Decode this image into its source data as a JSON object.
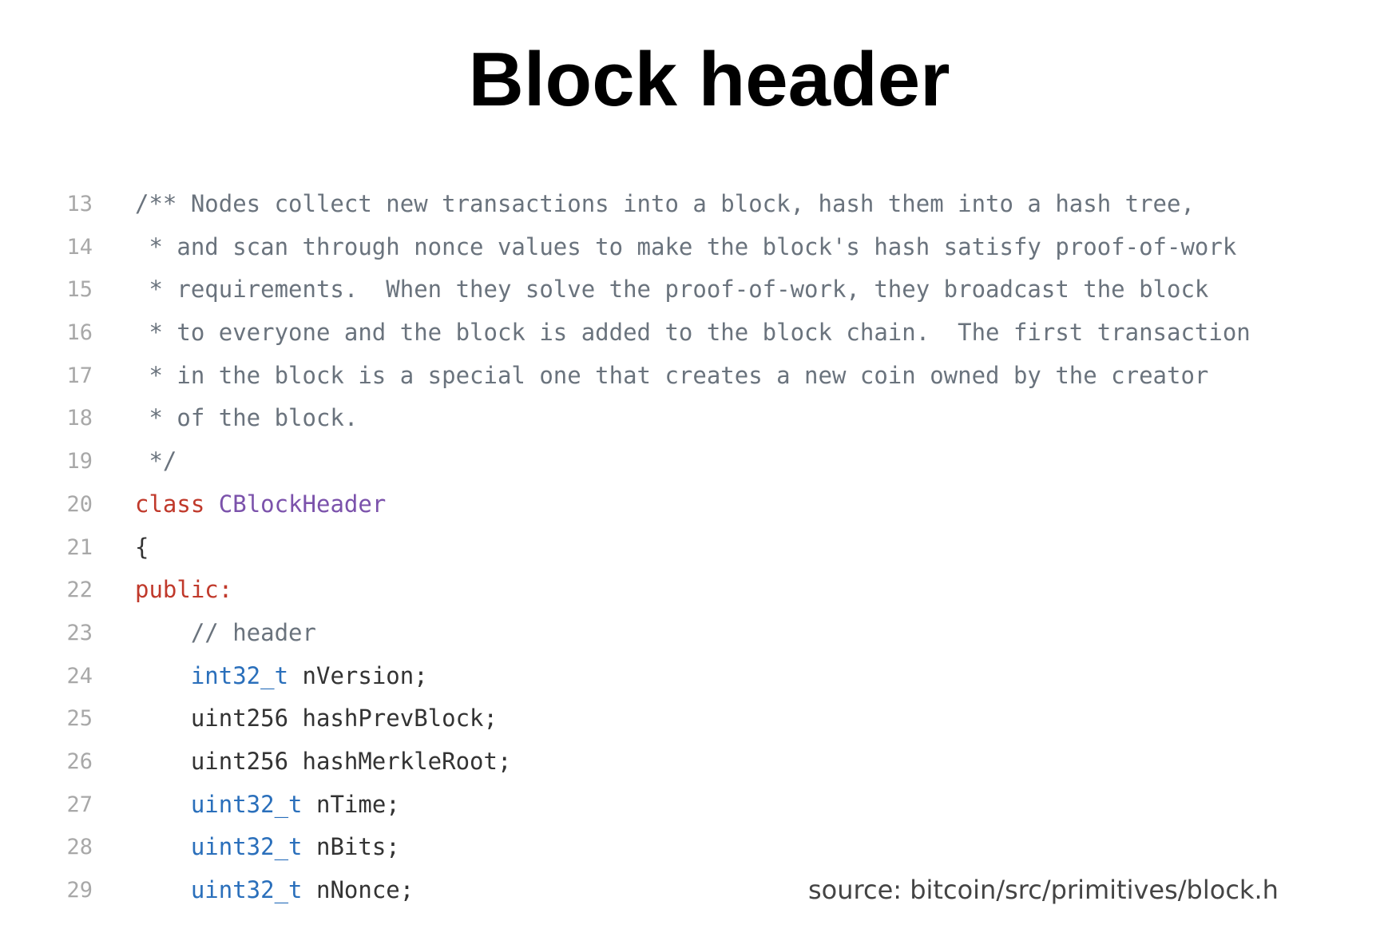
{
  "title": "Block header",
  "code": {
    "lines": [
      {
        "num": "13",
        "parts": [
          {
            "cls": "comment",
            "text": "/** Nodes collect new transactions into a block, hash them into a hash tree,"
          }
        ]
      },
      {
        "num": "14",
        "parts": [
          {
            "cls": "comment",
            "text": " * and scan through nonce values to make the block's hash satisfy proof-of-work"
          }
        ]
      },
      {
        "num": "15",
        "parts": [
          {
            "cls": "comment",
            "text": " * requirements.  When they solve the proof-of-work, they broadcast the block"
          }
        ]
      },
      {
        "num": "16",
        "parts": [
          {
            "cls": "comment",
            "text": " * to everyone and the block is added to the block chain.  The first transaction"
          }
        ]
      },
      {
        "num": "17",
        "parts": [
          {
            "cls": "comment",
            "text": " * in the block is a special one that creates a new coin owned by the creator"
          }
        ]
      },
      {
        "num": "18",
        "parts": [
          {
            "cls": "comment",
            "text": " * of the block."
          }
        ]
      },
      {
        "num": "19",
        "parts": [
          {
            "cls": "comment",
            "text": " */"
          }
        ]
      },
      {
        "num": "20",
        "parts": [
          {
            "cls": "kw",
            "text": "class"
          },
          {
            "cls": "plain",
            "text": " "
          },
          {
            "cls": "cls",
            "text": "CBlockHeader"
          }
        ]
      },
      {
        "num": "21",
        "parts": [
          {
            "cls": "plain",
            "text": "{"
          }
        ]
      },
      {
        "num": "22",
        "parts": [
          {
            "cls": "kw",
            "text": "public:"
          }
        ]
      },
      {
        "num": "23",
        "parts": [
          {
            "cls": "comment",
            "text": "    // header"
          }
        ]
      },
      {
        "num": "24",
        "parts": [
          {
            "cls": "plain",
            "text": "    "
          },
          {
            "cls": "type",
            "text": "int32_t"
          },
          {
            "cls": "plain",
            "text": " nVersion;"
          }
        ]
      },
      {
        "num": "25",
        "parts": [
          {
            "cls": "plain",
            "text": "    uint256 hashPrevBlock;"
          }
        ]
      },
      {
        "num": "26",
        "parts": [
          {
            "cls": "plain",
            "text": "    uint256 hashMerkleRoot;"
          }
        ]
      },
      {
        "num": "27",
        "parts": [
          {
            "cls": "plain",
            "text": "    "
          },
          {
            "cls": "type",
            "text": "uint32_t"
          },
          {
            "cls": "plain",
            "text": " nTime;"
          }
        ]
      },
      {
        "num": "28",
        "parts": [
          {
            "cls": "plain",
            "text": "    "
          },
          {
            "cls": "type",
            "text": "uint32_t"
          },
          {
            "cls": "plain",
            "text": " nBits;"
          }
        ]
      },
      {
        "num": "29",
        "parts": [
          {
            "cls": "plain",
            "text": "    "
          },
          {
            "cls": "type",
            "text": "uint32_t"
          },
          {
            "cls": "plain",
            "text": " nNonce;"
          }
        ]
      }
    ]
  },
  "source": "source: bitcoin/src/primitives/block.h",
  "colors": {
    "comment": "#6a737d",
    "keyword": "#c0392b",
    "class_name": "#7b52ab",
    "type": "#2a6fbb",
    "line_number": "#a8a8a8"
  }
}
